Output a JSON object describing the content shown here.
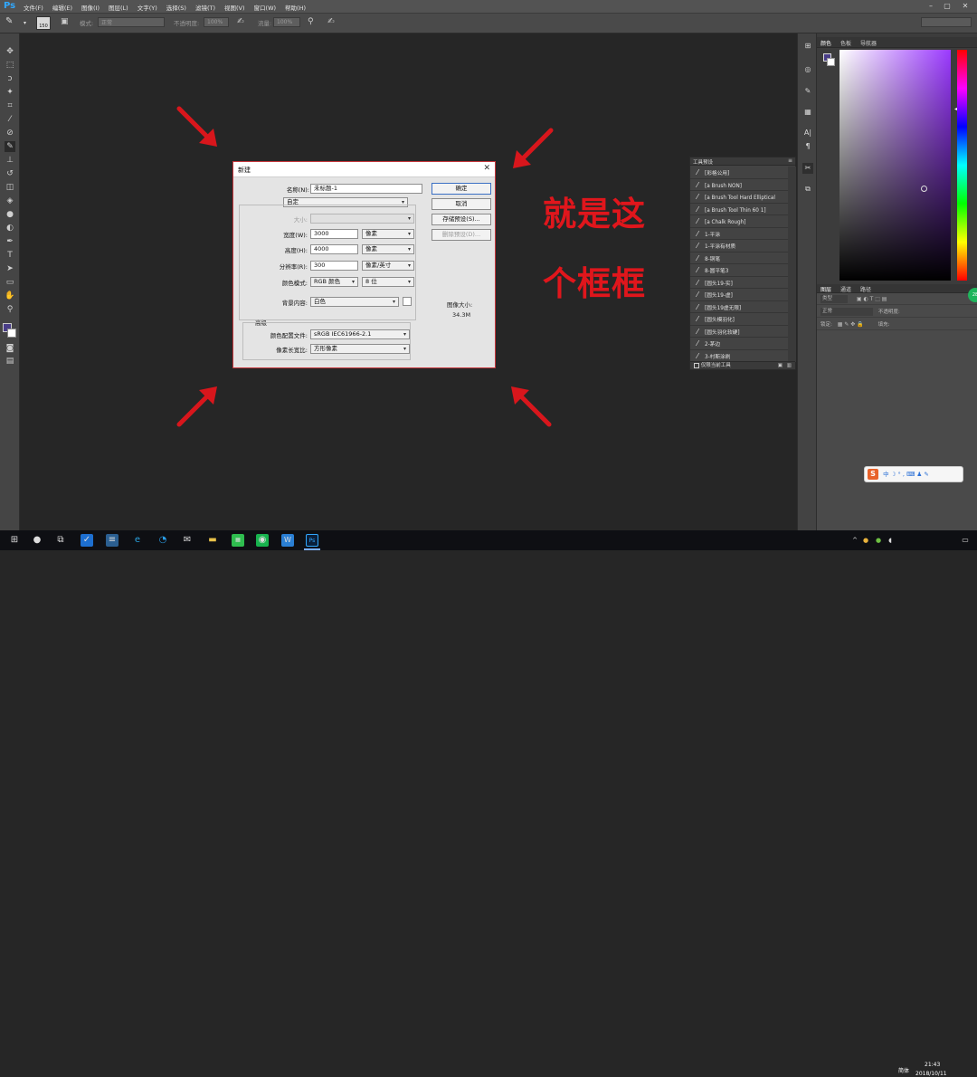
{
  "app": {
    "logo": "Ps"
  },
  "menu": [
    "文件(F)",
    "编辑(E)",
    "图像(I)",
    "图层(L)",
    "文字(Y)",
    "选择(S)",
    "滤镜(T)",
    "视图(V)",
    "窗口(W)",
    "帮助(H)"
  ],
  "options_bar": {
    "brush_size": "150",
    "mode_label": "模式:",
    "mode_value": "正常",
    "opacity_label": "不透明度:",
    "opacity_value": "100%",
    "flow_label": "流量:",
    "flow_value": "100%"
  },
  "dialog": {
    "title": "新建",
    "name_label": "名称(N):",
    "name_value": "未标题-1",
    "preset_label": "预设:",
    "preset_value": "自定",
    "size_label": "大小:",
    "width_label": "宽度(W):",
    "width_value": "3000",
    "width_unit": "像素",
    "height_label": "高度(H):",
    "height_value": "4000",
    "height_unit": "像素",
    "resolution_label": "分辨率(R):",
    "resolution_value": "300",
    "resolution_unit": "像素/英寸",
    "color_mode_label": "颜色模式:",
    "color_mode_value": "RGB 颜色",
    "bit_depth": "8 位",
    "background_label": "背景内容:",
    "background_value": "白色",
    "advanced_label": "高级",
    "profile_label": "颜色配置文件:",
    "profile_value": "sRGB IEC61966-2.1",
    "pixel_aspect_label": "像素长宽比:",
    "pixel_aspect_value": "方形像素",
    "ok_button": "确定",
    "cancel_button": "取消",
    "save_preset_button": "存储预设(S)...",
    "delete_preset_button": "删除预设(D)...",
    "image_size_label": "图像大小:",
    "image_size_value": "34.3M",
    "close_glyph": "✕"
  },
  "overlay_text": {
    "line1": "就是这",
    "line2": "个框框"
  },
  "overlay_color": "#e0161c",
  "presets_panel": {
    "title": "工具预设",
    "items": [
      "[彩格公用]",
      "[a Brush NON]",
      "[a Brush Tool Hard Elliptical",
      "[a Brush Tool Thin 60 1]",
      "[a Chalk Rough]",
      "1-平涂",
      "1-平涂有材质",
      "8-铜笔",
      "8-圆平笔3",
      "[圆头19-实]",
      "[圆头19-虚]",
      "[圆头19虚无限]",
      "[圆头模羽化]",
      "[圆头羽化软硬]",
      "2-茅边",
      "3-村斯涂刷"
    ],
    "footer": "仅限当前工具"
  },
  "color_panel": {
    "tabs": [
      "颜色",
      "色板",
      "导航器"
    ]
  },
  "layers_panel": {
    "tabs": [
      "图层",
      "通道",
      "路径"
    ],
    "kind_label": "类型",
    "blend_value": "正常",
    "opacity_label": "不透明度:",
    "lock_label": "锁定:",
    "fill_label": "填充:"
  },
  "ime_bar": {
    "logo": "S",
    "text": "中 ☽ ° ,  ⌨ ♟ ✎"
  },
  "green_badge": "28",
  "taskbar": {
    "time": "21:43",
    "date": "2018/10/11",
    "language": "简体"
  },
  "colors": {
    "dialog_border": "#c6363c",
    "foreground_color": "#4a3e88",
    "ps_blue": "#31a8ff"
  }
}
